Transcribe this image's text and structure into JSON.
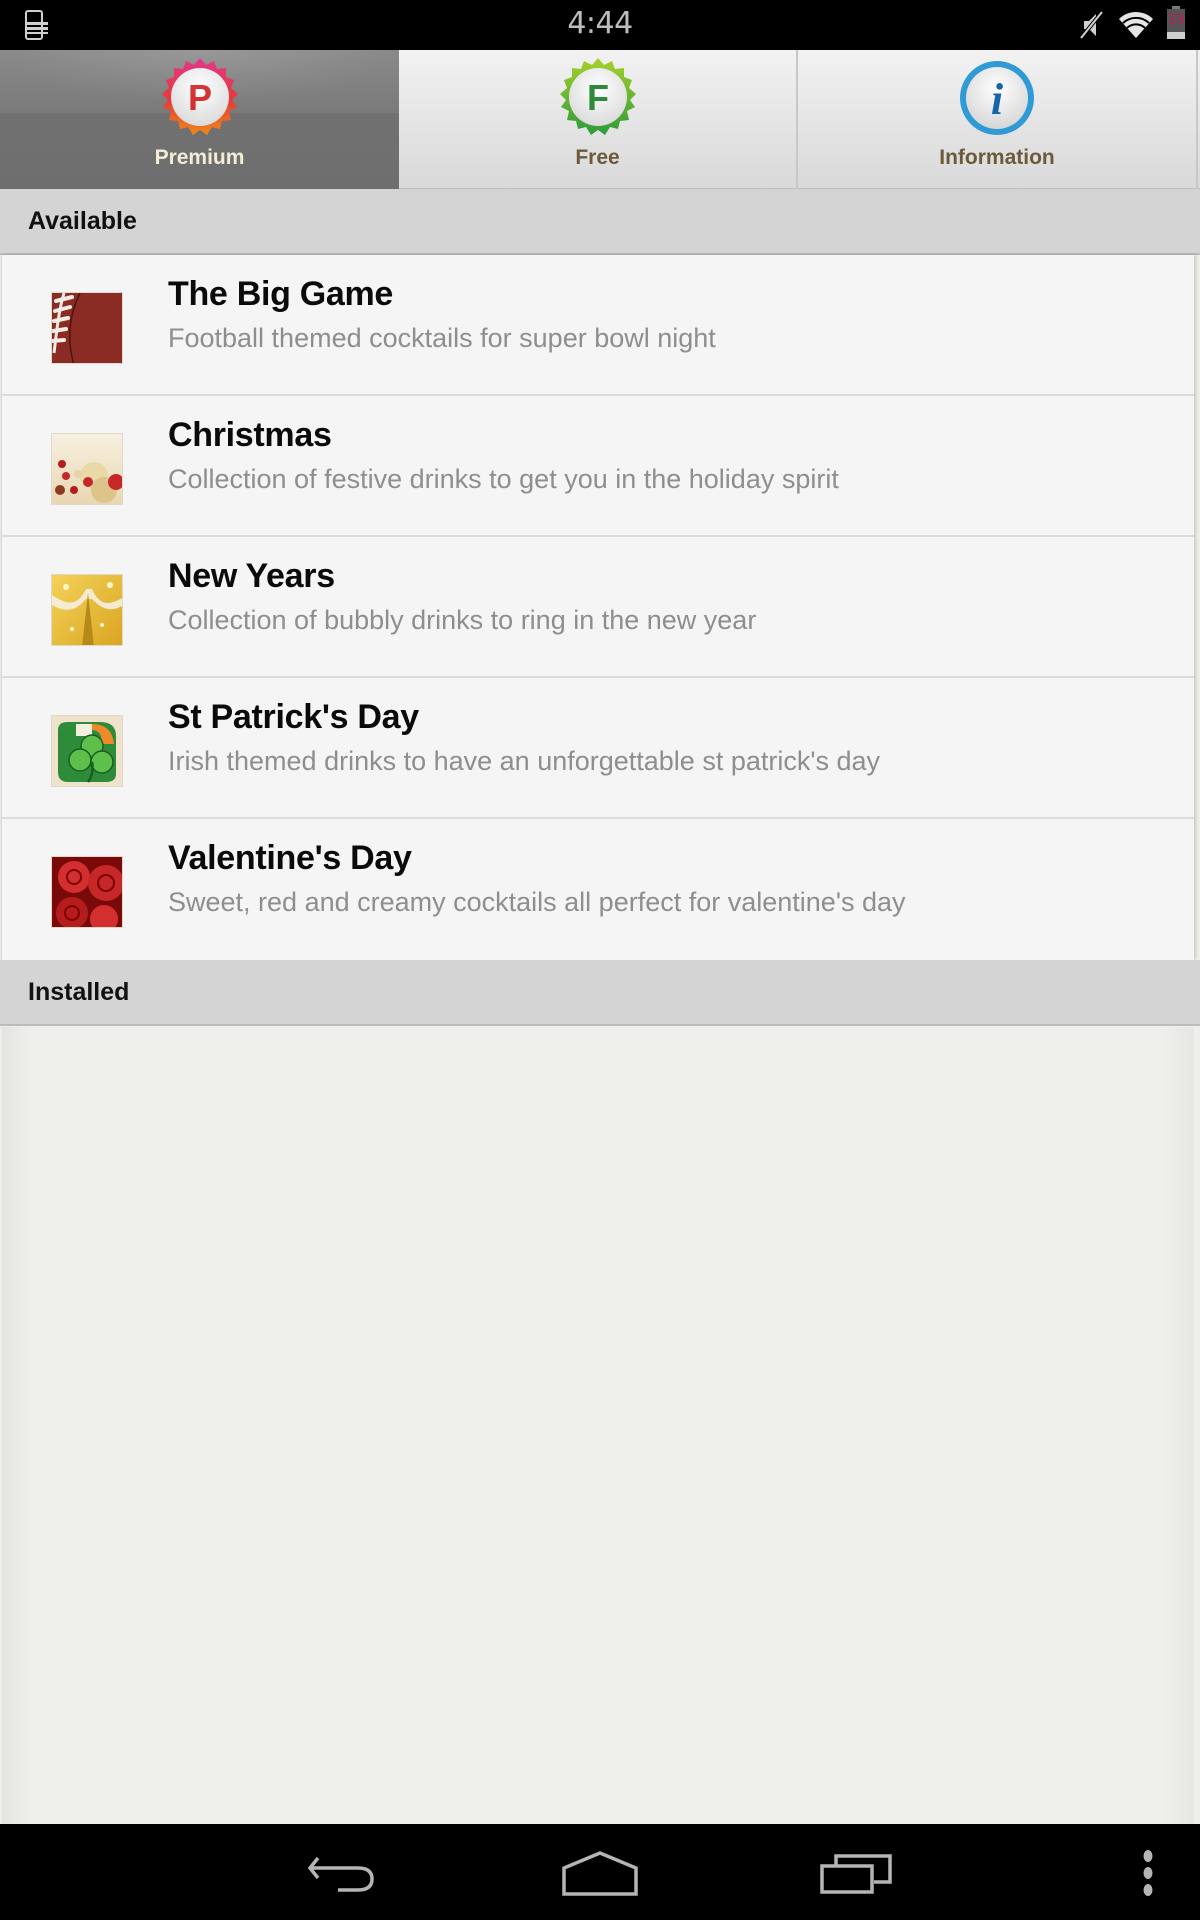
{
  "status_bar": {
    "time": "4:44",
    "battery_level": "19",
    "icons": [
      "notification-device-icon",
      "mute-icon",
      "wifi-icon",
      "battery-icon"
    ]
  },
  "tabs": [
    {
      "label": "Premium",
      "icon": "premium-badge-icon",
      "icon_letter": "P",
      "selected": true
    },
    {
      "label": "Free",
      "icon": "free-badge-icon",
      "icon_letter": "F",
      "selected": false
    },
    {
      "label": "Information",
      "icon": "info-icon",
      "icon_letter": "i",
      "selected": false
    }
  ],
  "sections": {
    "available": {
      "title": "Available",
      "items": [
        {
          "title": "The Big Game",
          "description": "Football themed cocktails for super bowl night",
          "thumb": "football-thumbnail"
        },
        {
          "title": "Christmas",
          "description": "Collection of festive drinks to get you in the holiday spirit",
          "thumb": "christmas-ornaments-thumbnail"
        },
        {
          "title": "New Years",
          "description": "Collection of bubbly drinks to ring in the new year",
          "thumb": "champagne-thumbnail"
        },
        {
          "title": "St Patrick's Day",
          "description": "Irish themed drinks to have an unforgettable st patrick's day",
          "thumb": "shamrock-thumbnail"
        },
        {
          "title": "Valentine's Day",
          "description": "Sweet, red and creamy cocktails all perfect for valentine's day",
          "thumb": "roses-thumbnail"
        }
      ]
    },
    "installed": {
      "title": "Installed",
      "items": []
    }
  },
  "nav_bar": {
    "buttons": [
      "back",
      "home",
      "recent-apps",
      "overflow-menu"
    ]
  },
  "colors": {
    "tab_label": "#6e5a3a",
    "tab_label_selected": "#f5ecd8",
    "premium_accent": "#d32f2f",
    "free_accent": "#2e9a3a",
    "info_accent": "#1e88c8"
  }
}
